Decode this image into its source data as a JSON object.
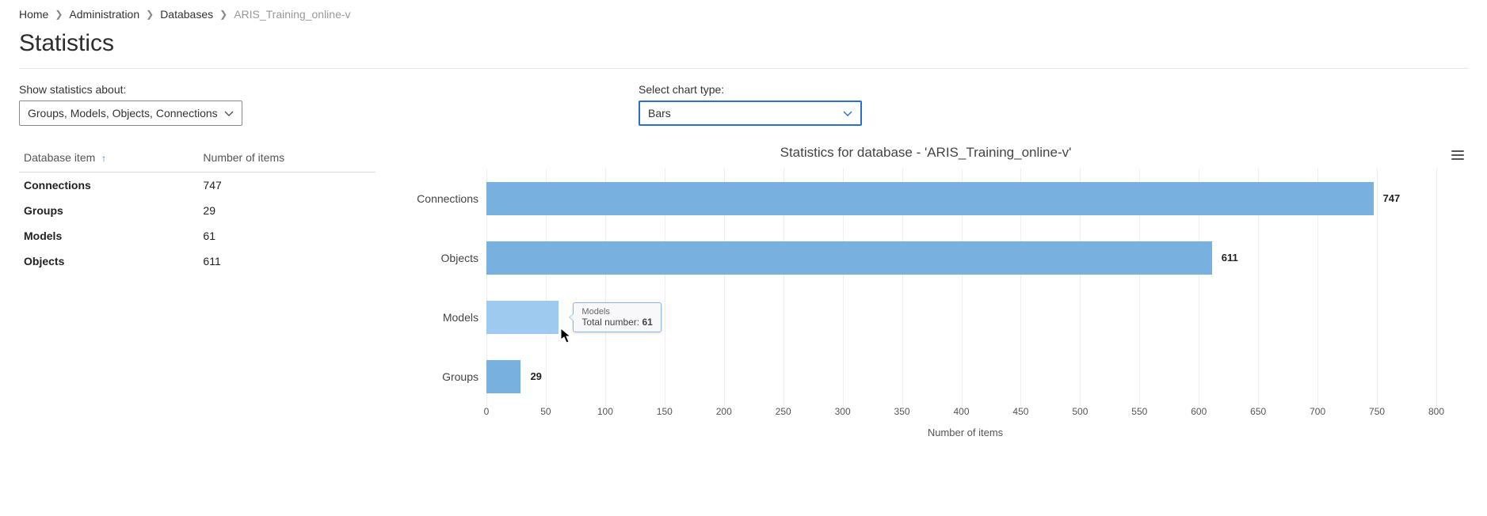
{
  "breadcrumb": {
    "items": [
      "Home",
      "Administration",
      "Databases"
    ],
    "current": "ARIS_Training_online-v"
  },
  "page_title": "Statistics",
  "controls": {
    "stats_label": "Show statistics about:",
    "stats_value": "Groups, Models, Objects, Connections",
    "chart_type_label": "Select chart type:",
    "chart_type_value": "Bars"
  },
  "table": {
    "col_item": "Database item",
    "col_count": "Number of items",
    "rows": [
      {
        "name": "Connections",
        "count": "747"
      },
      {
        "name": "Groups",
        "count": "29"
      },
      {
        "name": "Models",
        "count": "61"
      },
      {
        "name": "Objects",
        "count": "611"
      }
    ]
  },
  "chart_title": "Statistics for database - 'ARIS_Training_online-v'",
  "chart_data": {
    "type": "bar",
    "orientation": "horizontal",
    "title": "Statistics for database - 'ARIS_Training_online-v'",
    "xlabel": "Number of items",
    "ylabel": "",
    "categories": [
      "Connections",
      "Objects",
      "Models",
      "Groups"
    ],
    "values": [
      747,
      611,
      61,
      29
    ],
    "xlim": [
      0,
      800
    ],
    "xticks": [
      0,
      50,
      100,
      150,
      200,
      250,
      300,
      350,
      400,
      450,
      500,
      550,
      600,
      650,
      700,
      750,
      800
    ],
    "bar_color": "#78b0e0",
    "hover": {
      "category": "Models",
      "value": 61,
      "tooltip_series_label": "Models",
      "tooltip_metric_label": "Total number:"
    }
  },
  "x_axis_label": "Number of items",
  "tooltip": {
    "name": "Models",
    "metric_label": "Total number:",
    "value": "61"
  }
}
